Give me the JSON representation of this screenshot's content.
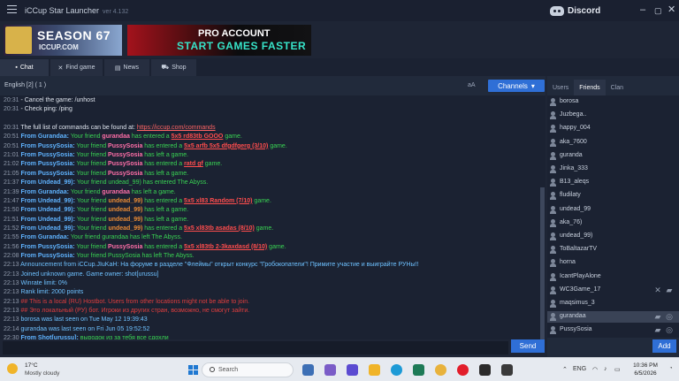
{
  "window": {
    "title": "iCCup Star Launcher",
    "version": "ver 4.132"
  },
  "discord": {
    "label": "Discord"
  },
  "banners": {
    "season": {
      "line1": "SEASON 67",
      "line2": "ICCUP.COM"
    },
    "pro": {
      "line1": "PRO ACCOUNT",
      "line2": "START GAMES FASTER"
    }
  },
  "tabs": [
    {
      "label": "Chat",
      "icon": "chat-icon"
    },
    {
      "label": "Find game",
      "icon": "swords-icon"
    },
    {
      "label": "News",
      "icon": "news-icon"
    },
    {
      "label": "Shop",
      "icon": "cart-icon"
    }
  ],
  "chat": {
    "room": "English [2] ( 1 )",
    "font_toggle": "aA",
    "channels_label": "Channels",
    "send_label": "Send",
    "messages": [
      {
        "parts": [
          {
            "t": "20:31",
            "c": "t"
          },
          {
            "t": " - Cancel the game: /unhost",
            "c": "c-white"
          }
        ]
      },
      {
        "parts": [
          {
            "t": "20:31",
            "c": "t"
          },
          {
            "t": " - Check ping: /ping",
            "c": "c-white"
          }
        ]
      },
      {
        "parts": [
          {
            "t": "",
            "c": "t"
          }
        ]
      },
      {
        "parts": [
          {
            "t": "20:31",
            "c": "t"
          },
          {
            "t": " The full list of commands can be found at: ",
            "c": "c-white"
          },
          {
            "t": "https://iccup.com/commands",
            "c": "c-link"
          }
        ]
      },
      {
        "parts": [
          {
            "t": "20:51",
            "c": "t"
          },
          {
            "t": "  From Gurandaa: ",
            "c": "c-blue"
          },
          {
            "t": "Your friend ",
            "c": "c-green"
          },
          {
            "t": "gurandaa",
            "c": "c-pink"
          },
          {
            "t": " has entered a ",
            "c": "c-green"
          },
          {
            "t": "5x5 rd83tb GOOO",
            "c": "c-redlink"
          },
          {
            "t": " game.",
            "c": "c-green"
          }
        ]
      },
      {
        "parts": [
          {
            "t": "20:51",
            "c": "t"
          },
          {
            "t": "  From PussySosia: ",
            "c": "c-blue"
          },
          {
            "t": "Your friend ",
            "c": "c-green"
          },
          {
            "t": "PussySosia",
            "c": "c-pink"
          },
          {
            "t": " has entered a ",
            "c": "c-green"
          },
          {
            "t": "5x5 arfb 5x5 dfgdfgerg (3/10)",
            "c": "c-redlink"
          },
          {
            "t": " game.",
            "c": "c-green"
          }
        ]
      },
      {
        "parts": [
          {
            "t": "21:01",
            "c": "t"
          },
          {
            "t": "  From PussySosia: ",
            "c": "c-blue"
          },
          {
            "t": "Your friend ",
            "c": "c-green"
          },
          {
            "t": "PussySosia",
            "c": "c-pink"
          },
          {
            "t": " has left a game.",
            "c": "c-green"
          }
        ]
      },
      {
        "parts": [
          {
            "t": "21:02",
            "c": "t"
          },
          {
            "t": "  From PussySosia: ",
            "c": "c-blue"
          },
          {
            "t": "Your friend ",
            "c": "c-green"
          },
          {
            "t": "PussySosia",
            "c": "c-pink"
          },
          {
            "t": " has entered a ",
            "c": "c-green"
          },
          {
            "t": "ratd gf",
            "c": "c-redlink"
          },
          {
            "t": " game.",
            "c": "c-green"
          }
        ]
      },
      {
        "parts": [
          {
            "t": "21:05",
            "c": "t"
          },
          {
            "t": "  From PussySosia: ",
            "c": "c-blue"
          },
          {
            "t": "Your friend ",
            "c": "c-green"
          },
          {
            "t": "PussySosia",
            "c": "c-pink"
          },
          {
            "t": " has left a game.",
            "c": "c-green"
          }
        ]
      },
      {
        "parts": [
          {
            "t": "21:37",
            "c": "t"
          },
          {
            "t": "  From Undead_99): ",
            "c": "c-blue"
          },
          {
            "t": "Your friend undead_99) has entered The Abyss.",
            "c": "c-green"
          }
        ]
      },
      {
        "parts": [
          {
            "t": "21:39",
            "c": "t"
          },
          {
            "t": "  From Gurandaa: ",
            "c": "c-blue"
          },
          {
            "t": "Your friend ",
            "c": "c-green"
          },
          {
            "t": "gurandaa",
            "c": "c-pink"
          },
          {
            "t": " has left a game.",
            "c": "c-green"
          }
        ]
      },
      {
        "parts": [
          {
            "t": "21:47",
            "c": "t"
          },
          {
            "t": "  From Undead_99): ",
            "c": "c-blue"
          },
          {
            "t": "Your friend ",
            "c": "c-green"
          },
          {
            "t": "undead_99)",
            "c": "c-orange"
          },
          {
            "t": " has entered a ",
            "c": "c-green"
          },
          {
            "t": "5x5 xl83 Random (7/10)",
            "c": "c-redlink"
          },
          {
            "t": " game.",
            "c": "c-green"
          }
        ]
      },
      {
        "parts": [
          {
            "t": "21:50",
            "c": "t"
          },
          {
            "t": "  From Undead_99): ",
            "c": "c-blue"
          },
          {
            "t": "Your friend ",
            "c": "c-green"
          },
          {
            "t": "undead_99)",
            "c": "c-orange"
          },
          {
            "t": " has left a game.",
            "c": "c-green"
          }
        ]
      },
      {
        "parts": [
          {
            "t": "21:51",
            "c": "t"
          },
          {
            "t": "  From Undead_99): ",
            "c": "c-blue"
          },
          {
            "t": "Your friend ",
            "c": "c-green"
          },
          {
            "t": "undead_99)",
            "c": "c-orange"
          },
          {
            "t": " has left a game.",
            "c": "c-green"
          }
        ]
      },
      {
        "parts": [
          {
            "t": "21:52",
            "c": "t"
          },
          {
            "t": "  From Undead_99): ",
            "c": "c-blue"
          },
          {
            "t": "Your friend ",
            "c": "c-green"
          },
          {
            "t": "undead_99)",
            "c": "c-orange"
          },
          {
            "t": " has entered a ",
            "c": "c-green"
          },
          {
            "t": "5x5 xl83tb asadas (8/10)",
            "c": "c-redlink"
          },
          {
            "t": " game.",
            "c": "c-green"
          }
        ]
      },
      {
        "parts": [
          {
            "t": "21:55",
            "c": "t"
          },
          {
            "t": "  From Gurandaa: ",
            "c": "c-blue"
          },
          {
            "t": "Your friend gurandaa has left The Abyss.",
            "c": "c-green"
          }
        ]
      },
      {
        "parts": [
          {
            "t": "21:56",
            "c": "t"
          },
          {
            "t": "  From PussySosia: ",
            "c": "c-blue"
          },
          {
            "t": "Your friend ",
            "c": "c-green"
          },
          {
            "t": "PussySosia",
            "c": "c-pink"
          },
          {
            "t": " has entered a ",
            "c": "c-green"
          },
          {
            "t": "5x5 xl83tb 2-3kaxdasd (8/10)",
            "c": "c-redlink"
          },
          {
            "t": " game.",
            "c": "c-green"
          }
        ]
      },
      {
        "parts": [
          {
            "t": "22:08",
            "c": "t"
          },
          {
            "t": "  From PussySosia: ",
            "c": "c-blue"
          },
          {
            "t": "Your friend PussySosia has left The Abyss.",
            "c": "c-green"
          }
        ]
      },
      {
        "parts": [
          {
            "t": "22:13",
            "c": "t"
          },
          {
            "t": " Announcement from iCCup.JIuKaH: На форуме в разделе \"Флеймы\" открыт конкурс \"Гробокопатели\"! Примите участие и выиграйте РУНы!!",
            "c": "c-info"
          }
        ]
      },
      {
        "parts": [
          {
            "t": "22:13",
            "c": "t"
          },
          {
            "t": " Joined unknown game. Game owner: shot[urussu]",
            "c": "c-info"
          }
        ]
      },
      {
        "parts": [
          {
            "t": "22:13",
            "c": "t"
          },
          {
            "t": " Winrate limit: 0%",
            "c": "c-info"
          }
        ]
      },
      {
        "parts": [
          {
            "t": "22:13",
            "c": "t"
          },
          {
            "t": " Rank limit: 2000 points",
            "c": "c-info"
          }
        ]
      },
      {
        "parts": [
          {
            "t": "22:13",
            "c": "t"
          },
          {
            "t": " ## This is a local (RU) Hostbot. Users from other locations might not be able to join.",
            "c": "c-red"
          }
        ]
      },
      {
        "parts": [
          {
            "t": "22:13",
            "c": "t"
          },
          {
            "t": " ## Это локальный (РУ) бот. Игроки из других стран, возможно, не смогут зайти.",
            "c": "c-red"
          }
        ]
      },
      {
        "parts": [
          {
            "t": "22:13",
            "c": "t"
          },
          {
            "t": " borosa was last seen on Tue May 12 19:39:43",
            "c": "c-info"
          }
        ]
      },
      {
        "parts": [
          {
            "t": "22:14",
            "c": "t"
          },
          {
            "t": " gurandaa was last seen on Fri Jun 05 19:52:52",
            "c": "c-info"
          }
        ]
      },
      {
        "parts": [
          {
            "t": "22:30",
            "c": "t"
          },
          {
            "t": "  From Shot[urussu]: ",
            "c": "c-blue"
          },
          {
            "t": "выродок из за тебя все сдохли",
            "c": "c-green"
          }
        ]
      }
    ]
  },
  "side": {
    "tabs": [
      "Users",
      "Friends",
      "Clan"
    ],
    "active_tab": "Friends",
    "add_label": "Add",
    "friends": [
      {
        "name": "borosa"
      },
      {
        "name": "Juzbega.."
      },
      {
        "name": "happy_004"
      },
      {
        "name": "aka_7600"
      },
      {
        "name": "guranda"
      },
      {
        "name": "Jinka_333"
      },
      {
        "name": "B13_aleqs"
      },
      {
        "name": "fludilaty"
      },
      {
        "name": "undead_99"
      },
      {
        "name": "aka_76)"
      },
      {
        "name": "undead_99)"
      },
      {
        "name": "ToBaltazarTV"
      },
      {
        "name": "horna"
      },
      {
        "name": "IcantPlayAlone"
      },
      {
        "name": "WC3Game_17",
        "icons": [
          "swords-icon",
          "chat-bubble-icon"
        ]
      },
      {
        "name": "maqsimus_3"
      },
      {
        "name": "gurandaa",
        "selected": true,
        "icons": [
          "chat-bubble-icon",
          "game-icon"
        ]
      },
      {
        "name": "PussySosia",
        "icons": [
          "chat-bubble-icon",
          "game-icon"
        ]
      }
    ]
  },
  "taskbar": {
    "weather": {
      "temp": "17°C",
      "cond": "Mostly cloudy",
      "badge": "1"
    },
    "search_placeholder": "Search",
    "tray": {
      "lang": "ENG"
    },
    "clock": {
      "time": "10:36 PM",
      "date": "6/5/2026"
    }
  }
}
